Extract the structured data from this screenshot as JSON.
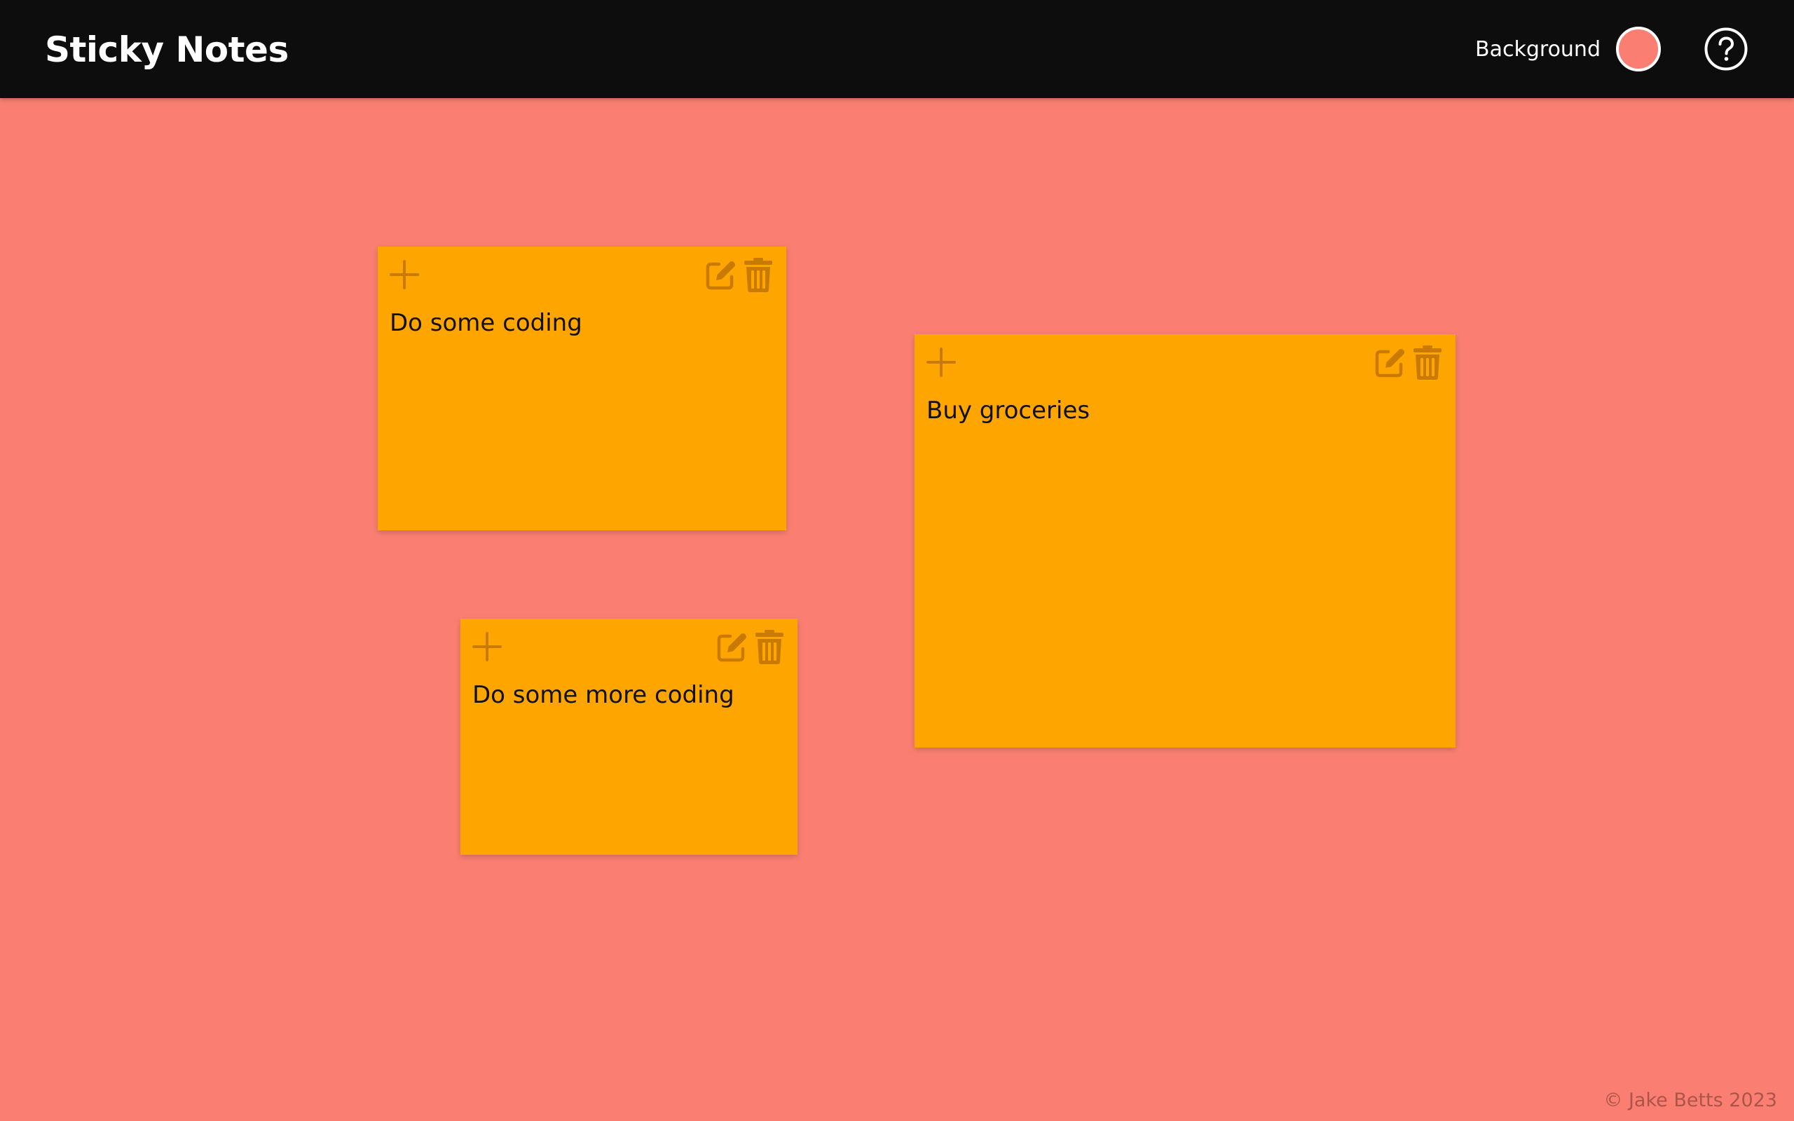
{
  "header": {
    "title": "Sticky Notes",
    "background_label": "Background",
    "background_color": "#fa7f72",
    "help_icon": "help-circle-icon"
  },
  "colors": {
    "header_bg": "#0d0d0d",
    "note": "#ffa500",
    "note_icon": "#c97a00"
  },
  "notes": [
    {
      "text": "Do some coding",
      "icons": [
        "plus-icon",
        "edit-icon",
        "trash-icon"
      ]
    },
    {
      "text": "Do some more coding",
      "icons": [
        "plus-icon",
        "edit-icon",
        "trash-icon"
      ]
    },
    {
      "text": "Buy groceries",
      "icons": [
        "plus-icon",
        "edit-icon",
        "trash-icon"
      ]
    }
  ],
  "footer": {
    "copyright": "© Jake Betts 2023"
  }
}
